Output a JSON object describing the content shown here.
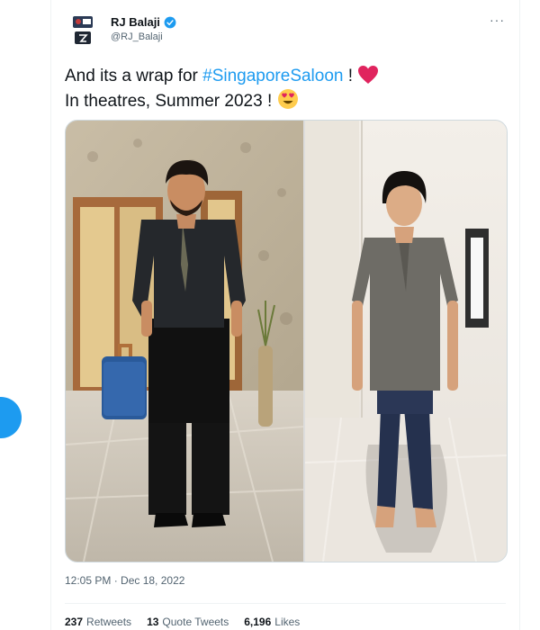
{
  "tweet": {
    "author": {
      "display_name": "RJ Balaji",
      "handle": "@RJ_Balaji",
      "verified": true
    },
    "more_icon": "···",
    "text_line1_prefix": "And its a wrap for ",
    "hashtag": "#SingaporeSaloon",
    "text_line1_suffix": " ! ",
    "text_line2": "In theatres, Summer 2023 ! ",
    "emojis": [
      "red-heart-icon",
      "heart-eyes-emoji-icon"
    ],
    "media": [
      {
        "name": "photo-man-black-shirt"
      },
      {
        "name": "photo-man-grey-shirt"
      }
    ],
    "timestamp": "12:05 PM · Dec 18, 2022",
    "stats": {
      "retweets_count": "237",
      "retweets_label": "Retweets",
      "quotes_count": "13",
      "quotes_label": "Quote Tweets",
      "likes_count": "6,196",
      "likes_label": "Likes"
    }
  },
  "colors": {
    "accent": "#1d9bf0",
    "text": "#0f1419",
    "secondary": "#536471",
    "heart": "#e0245e"
  }
}
